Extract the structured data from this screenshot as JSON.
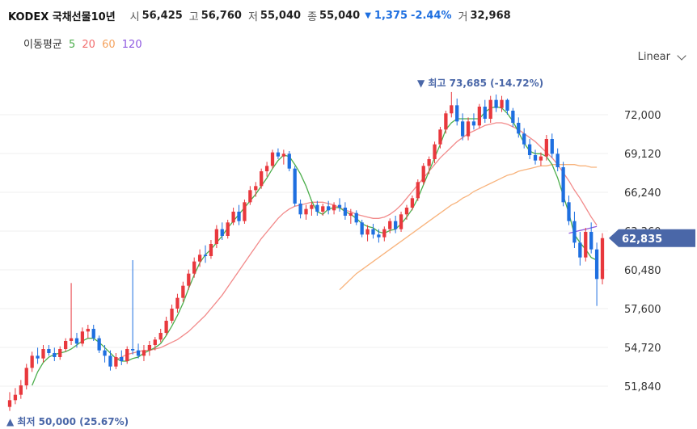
{
  "header": {
    "name": "KODEX 국채선물10년",
    "open_label": "시",
    "open": "56,425",
    "high_label": "고",
    "high": "56,760",
    "low_label": "저",
    "low": "55,040",
    "close_label": "종",
    "close": "55,040",
    "change_arrow": "▼",
    "change": "1,375",
    "change_pct": "-2.44%",
    "volume_label": "거",
    "volume": "32,968"
  },
  "ma_legend": {
    "label": "이동평균",
    "items": [
      {
        "text": "5",
        "color": "#4cae4c"
      },
      {
        "text": "20",
        "color": "#f26d6d"
      },
      {
        "text": "60",
        "color": "#f5a25d"
      },
      {
        "text": "120",
        "color": "#8e58e0"
      }
    ]
  },
  "scale_button": {
    "label": "Linear",
    "icon": "chevron-down-icon"
  },
  "colors": {
    "up": "#e8383d",
    "down": "#1e6fe0",
    "tag": "#4a67a8"
  },
  "annotations": {
    "high": {
      "arrow": "▼",
      "text": "최고 73,685 (-14.72%)"
    },
    "low": {
      "arrow": "▲",
      "text": "최저 50,000 (25.67%)"
    }
  },
  "current_price": "62,835",
  "chart_data": {
    "type": "candlestick",
    "ylim": [
      50000,
      74500
    ],
    "y_ticks": [
      "72,000",
      "69,120",
      "66,240",
      "63,360",
      "60,480",
      "57,600",
      "54,720",
      "51,840"
    ],
    "y_tick_values": [
      72000,
      69120,
      66240,
      63360,
      60480,
      57600,
      54720,
      51840
    ],
    "candles": [
      [
        50300,
        51400,
        50000,
        50800
      ],
      [
        50800,
        51700,
        50500,
        51200
      ],
      [
        51200,
        52300,
        50900,
        51900
      ],
      [
        51900,
        53500,
        51600,
        53200
      ],
      [
        53200,
        54400,
        52900,
        54100
      ],
      [
        54100,
        54700,
        53500,
        53900
      ],
      [
        53900,
        54900,
        53600,
        54600
      ],
      [
        54600,
        54900,
        54100,
        54300
      ],
      [
        54300,
        54700,
        53700,
        54000
      ],
      [
        54000,
        54800,
        53800,
        54600
      ],
      [
        54600,
        55400,
        54400,
        55200
      ],
      [
        55200,
        59500,
        54900,
        55400
      ],
      [
        55400,
        55800,
        54700,
        55000
      ],
      [
        55000,
        56200,
        54800,
        55900
      ],
      [
        55900,
        56400,
        55400,
        56100
      ],
      [
        56100,
        56400,
        55200,
        55400
      ],
      [
        55400,
        55600,
        54300,
        54500
      ],
      [
        54500,
        54900,
        53600,
        54100
      ],
      [
        54100,
        54500,
        53000,
        53300
      ],
      [
        53300,
        54300,
        53100,
        54000
      ],
      [
        54000,
        54500,
        53400,
        53700
      ],
      [
        53700,
        54800,
        53500,
        54600
      ],
      [
        54600,
        61200,
        54200,
        54500
      ],
      [
        54500,
        55000,
        53900,
        54100
      ],
      [
        54100,
        54900,
        53700,
        54500
      ],
      [
        54500,
        55200,
        54100,
        54900
      ],
      [
        54900,
        55500,
        54500,
        55300
      ],
      [
        55300,
        56100,
        55100,
        55800
      ],
      [
        55800,
        57000,
        55600,
        56700
      ],
      [
        56700,
        57900,
        56500,
        57600
      ],
      [
        57600,
        58700,
        57300,
        58400
      ],
      [
        58400,
        59600,
        58100,
        59300
      ],
      [
        59300,
        60500,
        59000,
        60200
      ],
      [
        60200,
        61400,
        59900,
        61100
      ],
      [
        61100,
        62000,
        60700,
        61600
      ],
      [
        61600,
        62300,
        61000,
        61500
      ],
      [
        61500,
        62700,
        61300,
        62400
      ],
      [
        62400,
        63800,
        62100,
        63500
      ],
      [
        63500,
        64000,
        62700,
        63000
      ],
      [
        63000,
        64200,
        62800,
        64000
      ],
      [
        64000,
        65100,
        63800,
        64800
      ],
      [
        64800,
        65300,
        63800,
        64100
      ],
      [
        64100,
        65700,
        63900,
        65500
      ],
      [
        65500,
        66700,
        65300,
        66400
      ],
      [
        66400,
        67000,
        65900,
        66700
      ],
      [
        66700,
        68000,
        66500,
        67800
      ],
      [
        67800,
        68500,
        67400,
        68200
      ],
      [
        68200,
        69400,
        68000,
        69200
      ],
      [
        69200,
        69500,
        68700,
        68900
      ],
      [
        68900,
        69400,
        68300,
        69100
      ],
      [
        69100,
        69300,
        67800,
        68000
      ],
      [
        68000,
        68200,
        65200,
        65400
      ],
      [
        65400,
        65700,
        64300,
        64600
      ],
      [
        64600,
        65300,
        64200,
        65000
      ],
      [
        65000,
        65500,
        64500,
        65300
      ],
      [
        65300,
        65600,
        64500,
        64800
      ],
      [
        64800,
        65400,
        64500,
        65200
      ],
      [
        65200,
        65600,
        64600,
        64900
      ],
      [
        64900,
        65500,
        64600,
        65300
      ],
      [
        65300,
        65800,
        64800,
        65100
      ],
      [
        65100,
        65500,
        64200,
        64500
      ],
      [
        64500,
        65000,
        63900,
        64700
      ],
      [
        64700,
        64900,
        63800,
        64000
      ],
      [
        64000,
        64200,
        62900,
        63100
      ],
      [
        63100,
        63800,
        62600,
        63500
      ],
      [
        63500,
        63900,
        62800,
        63100
      ],
      [
        63100,
        63500,
        62500,
        62900
      ],
      [
        62900,
        63700,
        62600,
        63500
      ],
      [
        63500,
        64300,
        63200,
        64100
      ],
      [
        64100,
        64500,
        63200,
        63500
      ],
      [
        63500,
        64800,
        63300,
        64600
      ],
      [
        64600,
        65300,
        64200,
        65100
      ],
      [
        65100,
        66000,
        64900,
        65800
      ],
      [
        65800,
        67200,
        65600,
        67000
      ],
      [
        67000,
        68400,
        66800,
        68200
      ],
      [
        68200,
        68900,
        67600,
        68700
      ],
      [
        68700,
        70000,
        68400,
        69800
      ],
      [
        69800,
        71100,
        69500,
        70900
      ],
      [
        70900,
        72300,
        70600,
        72100
      ],
      [
        72100,
        73685,
        71800,
        72700
      ],
      [
        72700,
        73200,
        71200,
        71500
      ],
      [
        71500,
        72100,
        70100,
        70400
      ],
      [
        70400,
        71800,
        70100,
        71500
      ],
      [
        71500,
        72100,
        70900,
        71200
      ],
      [
        71200,
        72800,
        71000,
        72600
      ],
      [
        72600,
        73100,
        71400,
        71700
      ],
      [
        71700,
        73400,
        71400,
        73100
      ],
      [
        73100,
        73500,
        72200,
        72500
      ],
      [
        72500,
        73400,
        72200,
        73100
      ],
      [
        73100,
        73200,
        72000,
        72300
      ],
      [
        72300,
        72500,
        71100,
        71400
      ],
      [
        71400,
        71800,
        70300,
        70600
      ],
      [
        70600,
        71000,
        69500,
        69800
      ],
      [
        69800,
        70200,
        68700,
        69000
      ],
      [
        69000,
        69400,
        68300,
        68600
      ],
      [
        68600,
        69200,
        68200,
        68900
      ],
      [
        68900,
        70500,
        68600,
        70200
      ],
      [
        70200,
        70600,
        68800,
        69100
      ],
      [
        69100,
        69500,
        67800,
        68100
      ],
      [
        68100,
        68500,
        65200,
        65500
      ],
      [
        65500,
        66000,
        63800,
        64100
      ],
      [
        64100,
        64800,
        62100,
        62500
      ],
      [
        62500,
        63300,
        60800,
        61400
      ],
      [
        61400,
        63600,
        61100,
        63300
      ],
      [
        63300,
        64000,
        61700,
        62000
      ],
      [
        62000,
        62500,
        57800,
        59800
      ],
      [
        59800,
        63200,
        59400,
        62835
      ]
    ],
    "ma5": [
      null,
      null,
      null,
      null,
      51900,
      52900,
      53600,
      54000,
      54200,
      54300,
      54400,
      54600,
      54900,
      55200,
      55400,
      55400,
      55100,
      54700,
      54300,
      53900,
      53700,
      53700,
      53900,
      54000,
      54300,
      54500,
      54700,
      55000,
      55600,
      56300,
      57100,
      58000,
      59100,
      60100,
      61000,
      61600,
      62000,
      62500,
      63000,
      63600,
      64100,
      64600,
      65100,
      65600,
      66100,
      66700,
      67300,
      68000,
      68600,
      69000,
      68900,
      68300,
      67600,
      66700,
      65600,
      64800,
      64600,
      65000,
      65100,
      65100,
      64800,
      64600,
      64300,
      63900,
      63700,
      63600,
      63300,
      63200,
      63400,
      63500,
      63900,
      64400,
      65000,
      65800,
      66800,
      67800,
      68800,
      69800,
      70900,
      71400,
      71700,
      71700,
      71700,
      71700,
      71700,
      72200,
      72500,
      72600,
      72500,
      72100,
      71500,
      70700,
      69900,
      69300,
      69100,
      69100,
      68900,
      68300,
      67300,
      66000,
      64700,
      63100,
      62500,
      62000,
      61400,
      61200
    ],
    "ma20": [
      null,
      null,
      null,
      null,
      null,
      null,
      null,
      null,
      null,
      null,
      null,
      null,
      null,
      null,
      null,
      null,
      null,
      null,
      null,
      53800,
      54000,
      54200,
      54300,
      54400,
      54500,
      54500,
      54600,
      54700,
      54900,
      55100,
      55300,
      55600,
      55900,
      56300,
      56700,
      57100,
      57600,
      58100,
      58600,
      59200,
      59800,
      60400,
      61000,
      61600,
      62200,
      62800,
      63300,
      63800,
      64300,
      64700,
      65000,
      65200,
      65300,
      65400,
      65500,
      65500,
      65500,
      65400,
      65300,
      65100,
      64900,
      64800,
      64600,
      64500,
      64400,
      64300,
      64300,
      64400,
      64600,
      64900,
      65300,
      65800,
      66300,
      66800,
      67300,
      67800,
      68300,
      68800,
      69200,
      69600,
      70000,
      70300,
      70600,
      70800,
      71000,
      71200,
      71300,
      71400,
      71400,
      71300,
      71100,
      70900,
      70600,
      70300,
      70000,
      69600,
      69200,
      68800,
      68300,
      67700,
      67100,
      66400,
      65800,
      65100,
      64400,
      63800
    ],
    "ma60": [
      null,
      null,
      null,
      null,
      null,
      null,
      null,
      null,
      null,
      null,
      null,
      null,
      null,
      null,
      null,
      null,
      null,
      null,
      null,
      null,
      null,
      null,
      null,
      null,
      null,
      null,
      null,
      null,
      null,
      null,
      null,
      null,
      null,
      null,
      null,
      null,
      null,
      null,
      null,
      null,
      null,
      null,
      null,
      null,
      null,
      null,
      null,
      null,
      null,
      null,
      null,
      null,
      null,
      null,
      null,
      null,
      null,
      null,
      null,
      59000,
      59400,
      59800,
      60200,
      60500,
      60800,
      61100,
      61400,
      61700,
      62000,
      62300,
      62600,
      62900,
      63200,
      63500,
      63800,
      64100,
      64400,
      64700,
      65000,
      65300,
      65500,
      65800,
      66000,
      66300,
      66500,
      66700,
      66900,
      67100,
      67300,
      67500,
      67600,
      67800,
      67900,
      68000,
      68100,
      68200,
      68200,
      68300,
      68300,
      68300,
      68300,
      68300,
      68200,
      68200,
      68100,
      68100
    ],
    "ma120": [
      null,
      null,
      null,
      null,
      null,
      null,
      null,
      null,
      null,
      null,
      null,
      null,
      null,
      null,
      null,
      null,
      null,
      null,
      null,
      null,
      null,
      null,
      null,
      null,
      null,
      null,
      null,
      null,
      null,
      null,
      null,
      null,
      null,
      null,
      null,
      null,
      null,
      null,
      null,
      null,
      null,
      null,
      null,
      null,
      null,
      null,
      null,
      null,
      null,
      null,
      null,
      null,
      null,
      null,
      null,
      null,
      null,
      null,
      null,
      null,
      null,
      null,
      null,
      null,
      null,
      null,
      null,
      null,
      null,
      null,
      null,
      null,
      null,
      null,
      null,
      null,
      null,
      null,
      null,
      null,
      null,
      null,
      null,
      null,
      null,
      null,
      null,
      null,
      null,
      null,
      null,
      null,
      null,
      null,
      null,
      null,
      null,
      null,
      null,
      null,
      63200,
      63300,
      63400,
      63500,
      63600,
      63700
    ]
  }
}
